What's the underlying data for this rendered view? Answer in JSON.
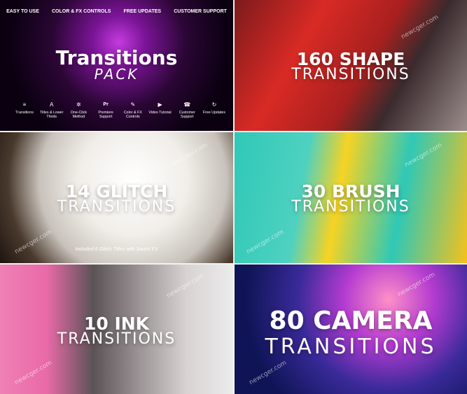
{
  "pack": {
    "bar": [
      "EASY TO USE",
      "COLOR & FX CONTROLS",
      "FREE UPDATES",
      "CUSTOMER SUPPORT"
    ],
    "title_line1": "Transitions",
    "title_line2": "PACK",
    "features": [
      {
        "icon": "list-icon",
        "glyph": "≡",
        "label": "Transitions"
      },
      {
        "icon": "text-icon",
        "glyph": "A",
        "label": "Titles & Lower Thirds"
      },
      {
        "icon": "gears-icon",
        "glyph": "✲",
        "label": "One-Click Method"
      },
      {
        "icon": "premiere-icon",
        "glyph": "Pr",
        "label": "Premiere Support"
      },
      {
        "icon": "brush-icon",
        "glyph": "✎",
        "label": "Color & FX Controls"
      },
      {
        "icon": "play-icon",
        "glyph": "▶",
        "label": "Video Tutorial"
      },
      {
        "icon": "support-icon",
        "glyph": "☎",
        "label": "Customer Support"
      },
      {
        "icon": "refresh-icon",
        "glyph": "↻",
        "label": "Free Updates"
      }
    ]
  },
  "shape": {
    "line1": "160 SHAPE",
    "line2": "TRANSITIONS"
  },
  "glitch": {
    "line1": "14 GLITCH",
    "line2": "TRANSITIONS",
    "note": "Included 6 Glitch Titles with Sound FX"
  },
  "brush": {
    "line1": "30 BRUSH",
    "line2": "TRANSITIONS"
  },
  "ink": {
    "line1": "10 INK",
    "line2": "TRANSITIONS"
  },
  "camera": {
    "line1": "80 CAMERA",
    "line2": "TRANSITIONS"
  },
  "watermark": "newcger.com"
}
